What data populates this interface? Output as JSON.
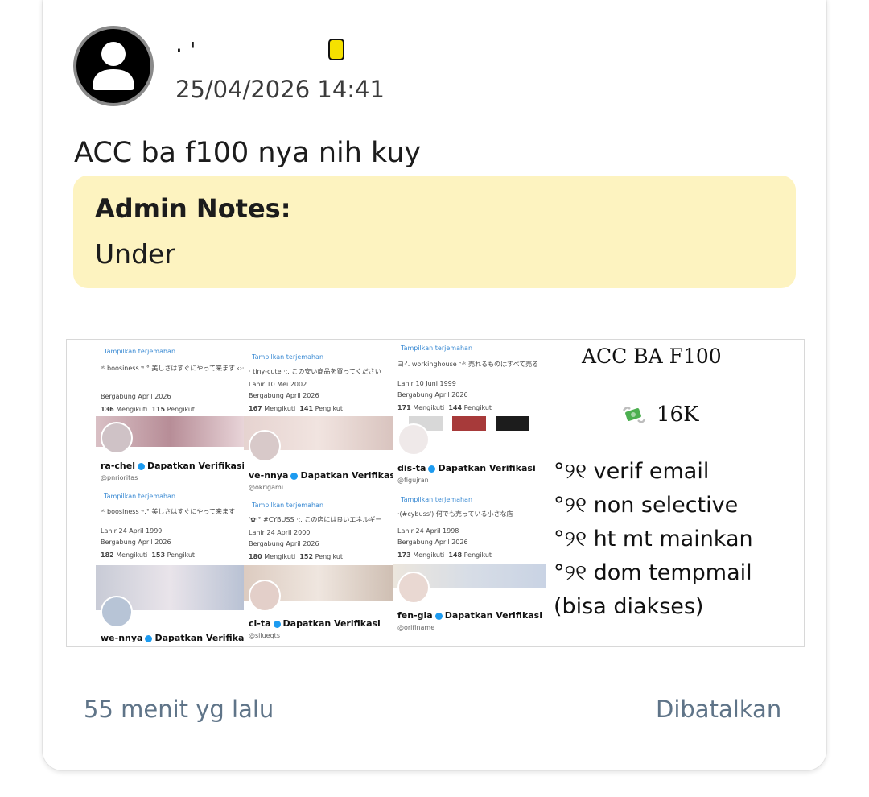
{
  "post": {
    "username": "·            '",
    "timestamp": "25/04/2026 14:41",
    "text": "ACC ba f100 nya nih kuy",
    "admin_notes_title": "Admin Notes:",
    "admin_notes_body": "Under",
    "time_ago": "55 menit yg lalu",
    "status": "Dibatalkan"
  },
  "attachment": {
    "profiles": [
      {
        "translate": "Tampilkan terjemahan",
        "bio": "ᵃᵗ boosiness ʷ.° 美しさはすぐにやって来ます ‹›·",
        "born": "",
        "joined": "Bergabung April 2026",
        "following": "136",
        "followers": "115",
        "following_label": "Mengikuti",
        "followers_label": "Pengikut",
        "name": "ra-chel",
        "verify": "Dapatkan Verifikasi",
        "handle": "@pnrioritas"
      },
      {
        "translate": "Tampilkan terjemahan",
        "bio": "ᵃᵗ boosiness ʷ.° 美しさはすぐにやって来ます",
        "born": "Lahir 24 April 1999",
        "joined": "Bergabung April 2026",
        "following": "182",
        "followers": "153",
        "following_label": "Mengikuti",
        "followers_label": "Pengikut",
        "name": "we-nnya",
        "verify": "Dapatkan Verifikasi",
        "handle": ""
      },
      {
        "translate": "Tampilkan terjemahan",
        "bio": "· tiny-cute ·:. この安い商品を買ってください",
        "born": "Lahir 10 Mei 2002",
        "joined": "Bergabung April 2026",
        "following": "167",
        "followers": "141",
        "following_label": "Mengikuti",
        "followers_label": "Pengikut",
        "name": "ve-nnya",
        "verify": "Dapatkan Verifikasi",
        "handle": "@okrigami"
      },
      {
        "translate": "Tampilkan terjemahan",
        "bio": "'✿·° #CYBUSS ·:. この店には良いエネルギー",
        "born": "Lahir 24 April 2000",
        "joined": "Bergabung April 2026",
        "following": "180",
        "followers": "152",
        "following_label": "Mengikuti",
        "followers_label": "Pengikut",
        "name": "ci-ta",
        "verify": "Dapatkan Verifikasi",
        "handle": "@silueqts"
      },
      {
        "translate": "Tampilkan terjemahan",
        "bio": "ヨ·'. workinghouse ᵔ·ᵏ 売れるものはすべて売る",
        "born": "Lahir 10 Juni 1999",
        "joined": "Bergabung April 2026",
        "following": "171",
        "followers": "144",
        "following_label": "Mengikuti",
        "followers_label": "Pengikut",
        "name": "dis-ta",
        "verify": "Dapatkan Verifikasi",
        "handle": "@figujran"
      },
      {
        "translate": "Tampilkan terjemahan",
        "bio": "·(#cybuss') 何でも売っている小さな店",
        "born": "Lahir 24 April 1998",
        "joined": "Bergabung April 2026",
        "following": "173",
        "followers": "148",
        "following_label": "Mengikuti",
        "followers_label": "Pengikut",
        "name": "fen-gia",
        "verify": "Dapatkan Verifikasi",
        "handle": "@orifiname"
      }
    ],
    "promo": {
      "title": "ACC BA F100",
      "price": "16K",
      "features": [
        "°୨୧ verif email",
        "°୨୧ non selective",
        "°୨୧ ht mt mainkan",
        "°୨୧ dom tempmail",
        "(bisa diakses)"
      ]
    }
  },
  "colors": {
    "badge": "#f5e100",
    "notes_bg": "#fdf3c0",
    "footer_text": "#5f7488",
    "verify_blue": "#1d9bf0"
  },
  "icons": {
    "avatar": "default-user-icon",
    "badge": "yellow-badge-icon",
    "price": "money-with-wings-icon"
  }
}
